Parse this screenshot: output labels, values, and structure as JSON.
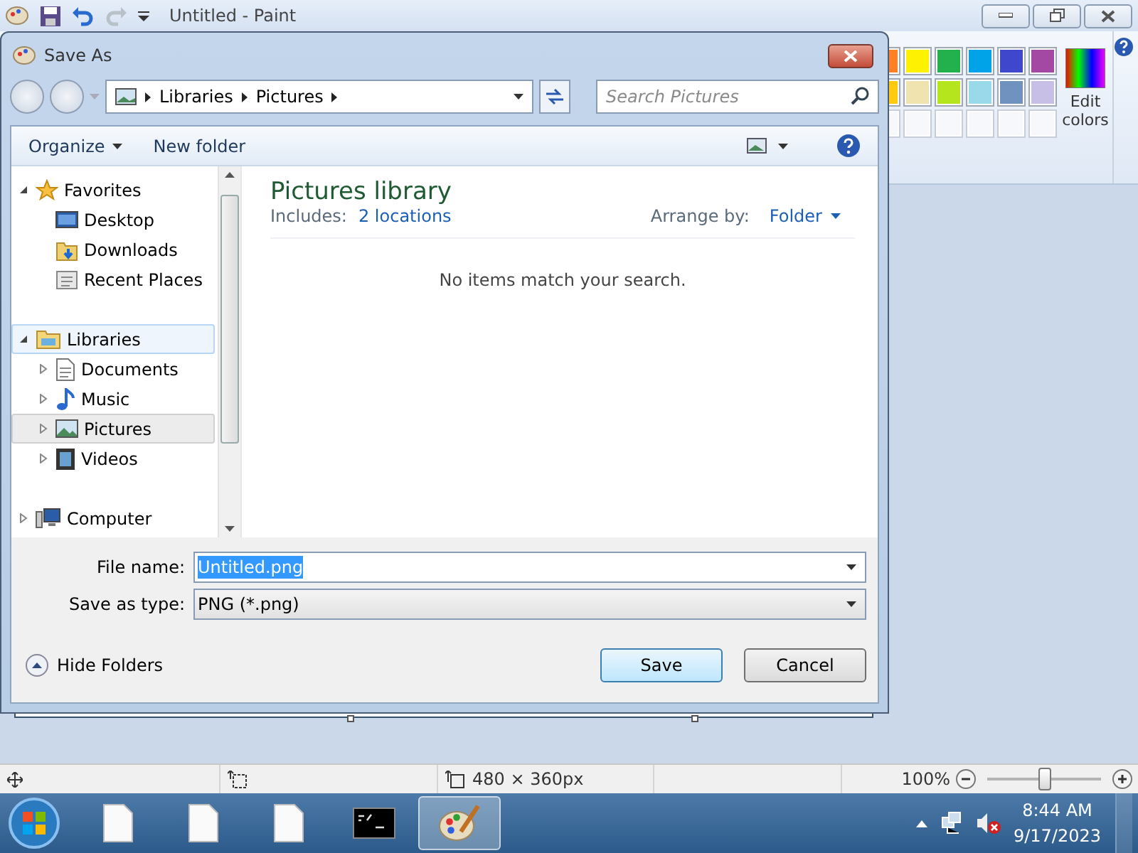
{
  "paint": {
    "title": "Untitled - Paint",
    "palette": [
      {
        "color": "#ff7f27"
      },
      {
        "color": "#fff200"
      },
      {
        "color": "#22b14c"
      },
      {
        "color": "#00a2e8"
      },
      {
        "color": "#3f48cc"
      },
      {
        "color": "#a349a4"
      },
      {
        "color": "#ffc90e"
      },
      {
        "color": "#efe4b0"
      },
      {
        "color": "#b5e61d"
      },
      {
        "color": "#99d9ea"
      },
      {
        "color": "#7092be"
      },
      {
        "color": "#c8bfe7"
      }
    ],
    "edit_colors": "Edit colors"
  },
  "dialog": {
    "title": "Save As",
    "breadcrumb": [
      "Libraries",
      "Pictures"
    ],
    "search": {
      "placeholder": "Search Pictures"
    },
    "toolbar": [
      "Organize",
      "New folder"
    ],
    "tree": [
      {
        "label": "Favorites",
        "kind": "star",
        "expanded": true,
        "selected": false,
        "hovered": false,
        "children": [
          {
            "label": "Desktop",
            "kind": "desktop",
            "selected": false,
            "hovered": false
          },
          {
            "label": "Downloads",
            "kind": "downloads",
            "selected": false,
            "hovered": false
          },
          {
            "label": "Recent Places",
            "kind": "recent",
            "selected": false,
            "hovered": false
          }
        ]
      },
      {
        "label": "Libraries",
        "kind": "library",
        "expanded": true,
        "selected": false,
        "hovered": true,
        "children": [
          {
            "label": "Documents",
            "kind": "documents",
            "expanded": false,
            "selected": false,
            "hovered": false
          },
          {
            "label": "Music",
            "kind": "music",
            "expanded": false,
            "selected": false,
            "hovered": false
          },
          {
            "label": "Pictures",
            "kind": "pictures",
            "expanded": false,
            "selected": true,
            "hovered": false
          },
          {
            "label": "Videos",
            "kind": "videos",
            "expanded": false,
            "selected": false,
            "hovered": false
          }
        ]
      },
      {
        "label": "Computer",
        "kind": "computer",
        "expanded": false,
        "selected": false,
        "hovered": false
      }
    ],
    "library_title": "Pictures library",
    "includes_label": "Includes:",
    "includes_link": "2 locations",
    "arrange_label": "Arrange by:",
    "arrange_value": "Folder",
    "empty_message": "No items match your search.",
    "file_name_label": "File name:",
    "file_name": "Untitled.png",
    "type_label": "Save as type:",
    "type_value": "PNG (*.png)",
    "hide_folders": "Hide Folders",
    "buttons": [
      "Save",
      "Cancel"
    ]
  },
  "status_bar": {
    "size": "480 × 360px",
    "zoom": "100%",
    "zoom_slider": {
      "level": 0.5
    }
  },
  "taskbar": {
    "apps": [
      {
        "kind": "doc",
        "selected": false
      },
      {
        "kind": "doc",
        "selected": false
      },
      {
        "kind": "doc",
        "selected": false
      },
      {
        "kind": "cmd",
        "selected": false
      },
      {
        "kind": "paint",
        "selected": true
      }
    ],
    "time": "8:44 AM",
    "date": "9/17/2023"
  }
}
